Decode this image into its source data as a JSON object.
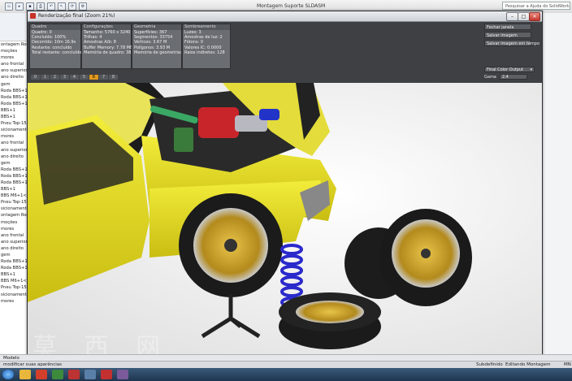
{
  "host": {
    "title": "Montagem Suporte SLDASM",
    "search_placeholder": "Pesquisar a Ajuda do SolidWorks",
    "tree_items": [
      "ontagem Rodi",
      "moções",
      "mores",
      "ano frontal",
      "ano superior",
      "ano direito",
      "gem",
      "Roda BBS+1",
      "Roda BBS+1",
      "Roda BBS+1",
      "BBS+1",
      "BBS+1",
      "Pneu Top-15",
      "sicionamento",
      "mores",
      "ano frontal",
      "ano superior",
      "ano direito",
      "gem",
      "Roda BBS+1",
      "Roda BBS+1",
      "Roda BBS+1",
      "BBS+1",
      "BBS M6+1<",
      "Pneu Top-15",
      "sicionamento",
      "ontagem Rodi",
      "moções",
      "mores",
      "ano frontal",
      "ano superior",
      "ano direito",
      "gem",
      "Roda BBS+1",
      "Roda BBS+1",
      "BBS+1",
      "BBS M6+1<",
      "Pneu Top-15",
      "sicionamento",
      "mores"
    ],
    "bottom_tab": "Modelo",
    "status_left": "modificar suas aparências",
    "status_mid1": "Subdefinido",
    "status_mid2": "Editando Montagem",
    "status_right": "MN"
  },
  "render_window": {
    "title": "Renderização final (Zoom 21%)",
    "panels": [
      {
        "header": "Quadro",
        "lines": [
          "Quadro: 0",
          "Concluído: 100%",
          "Decorrido: 10m 16.9s",
          "Restante: concluído",
          "Total restante: concluído"
        ]
      },
      {
        "header": "Configurações",
        "lines": [
          "Tamanho: 5760 x 3240",
          "Trilhas: 4",
          "Amostras A/b: 8",
          "Buffer Memory: 7.78 MB",
          "Memória de quadro: 385 MB"
        ]
      },
      {
        "header": "Geometria",
        "lines": [
          "Superfícies: 367",
          "Segmentos: 33754",
          "Vértices: 3.67 M",
          "Polígonos: 3.93 M",
          "Memória de geometria: 240"
        ]
      },
      {
        "header": "Sombreamento",
        "lines": [
          "Luzes: 3",
          "Amostras de luz: 2",
          "Fótons: 0",
          "Valores IC: 0.0000",
          "Raios indiretos: 128"
        ]
      }
    ],
    "buttons": [
      "Fechar janela",
      "Salvar imagem",
      "Salvar imagem em tempo"
    ],
    "output_select": "Final Color Output",
    "gamma_label": "Gama",
    "gamma_value": "2.4",
    "page_numbers": [
      "0",
      "1",
      "2",
      "3",
      "4",
      "5",
      "6",
      "7",
      "8"
    ],
    "active_page": "6"
  },
  "watermark": "莫 西 网"
}
